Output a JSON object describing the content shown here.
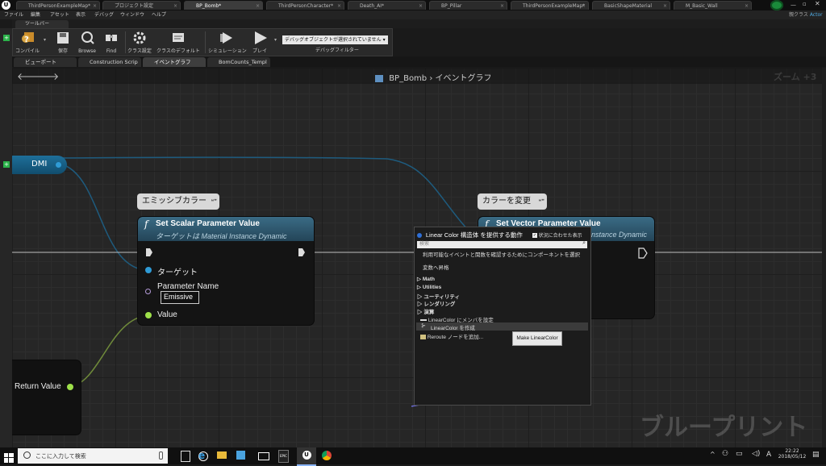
{
  "doc_tabs": [
    {
      "label": "ThirdPersonExampleMap*",
      "active": false
    },
    {
      "label": "プロジェクト設定",
      "active": false
    },
    {
      "label": "BP_Bomb*",
      "active": true
    },
    {
      "label": "ThirdPersonCharacter*",
      "active": false
    },
    {
      "label": "Death_AI*",
      "active": false
    },
    {
      "label": "BP_Pillar",
      "active": false
    },
    {
      "label": "ThirdPersonExampleMap*",
      "active": false
    },
    {
      "label": "BasicShapeMaterial",
      "active": false
    },
    {
      "label": "M_Basic_Wall",
      "active": false
    }
  ],
  "parent_class": {
    "label": "親クラス",
    "value": "Actor"
  },
  "menu": [
    "ファイル",
    "編集",
    "アセット",
    "表示",
    "デバッグ",
    "ウィンドウ",
    "ヘルプ"
  ],
  "toolbar_tab": "ツールバー",
  "toolbar": {
    "compile": "コンパイル",
    "save": "保存",
    "browse": "Browse",
    "find": "Find",
    "class_settings": "クラス設定",
    "class_defaults": "クラスのデフォルト",
    "simulation": "シミュレーション",
    "play": "プレイ",
    "debug_select": "デバッグオブジェクトが選択されていません",
    "debug_filter": "デバッグフィルター"
  },
  "graph_tabs": [
    {
      "label": "ビューポート",
      "active": false
    },
    {
      "label": "Construction Scrip",
      "active": false
    },
    {
      "label": "イベントグラフ",
      "active": true
    },
    {
      "label": "BomCounts_Templ",
      "active": false
    }
  ],
  "breadcrumb": {
    "blueprint": "BP_Bomb",
    "separator": "›",
    "graph": "イベントグラフ"
  },
  "zoom": "ズーム +3",
  "nodes": {
    "dmi": "DMI",
    "return_value": "Return Value",
    "set_scalar": {
      "comment": "エミッシブカラー",
      "title": "Set Scalar Parameter Value",
      "subtitle": "ターゲットは Material Instance Dynamic",
      "target": "ターゲット",
      "param_name": "Parameter Name",
      "param_value": "Emissive",
      "value": "Value"
    },
    "set_vector": {
      "comment": "カラーを変更",
      "title": "Set Vector Parameter Value",
      "subtitle_partial": "nstance Dynamic"
    }
  },
  "context_menu": {
    "title": "Linear Color 構造体 を提供する動作",
    "context_sensitive": "状況に合わせた表示",
    "search_placeholder": "検索",
    "hint": "利用可能なイベントと関数を確認するためにコンポーネントを選択",
    "promote": "変数へ昇格",
    "categories": [
      "Math",
      "Utilities",
      "ユーティリティ",
      "レンダリング",
      "演算"
    ],
    "items": [
      "LinearColor にメンバを設定",
      "LinearColor を作成",
      "Reroute ノードを追加..."
    ],
    "tooltip": "Make LinearColor"
  },
  "watermark": "ブループリント",
  "taskbar": {
    "search_placeholder": "ここに入力して検索",
    "lang": "A",
    "time": "22:22",
    "date": "2018/05/12"
  },
  "colors": {
    "node_header": "#3a6b85",
    "exec_wire": "#dddddd",
    "object_pin": "#2f9bd6",
    "float_pin": "#9ee04a",
    "name_pin": "#b49bd8",
    "accent_green": "#1a8a3a"
  }
}
